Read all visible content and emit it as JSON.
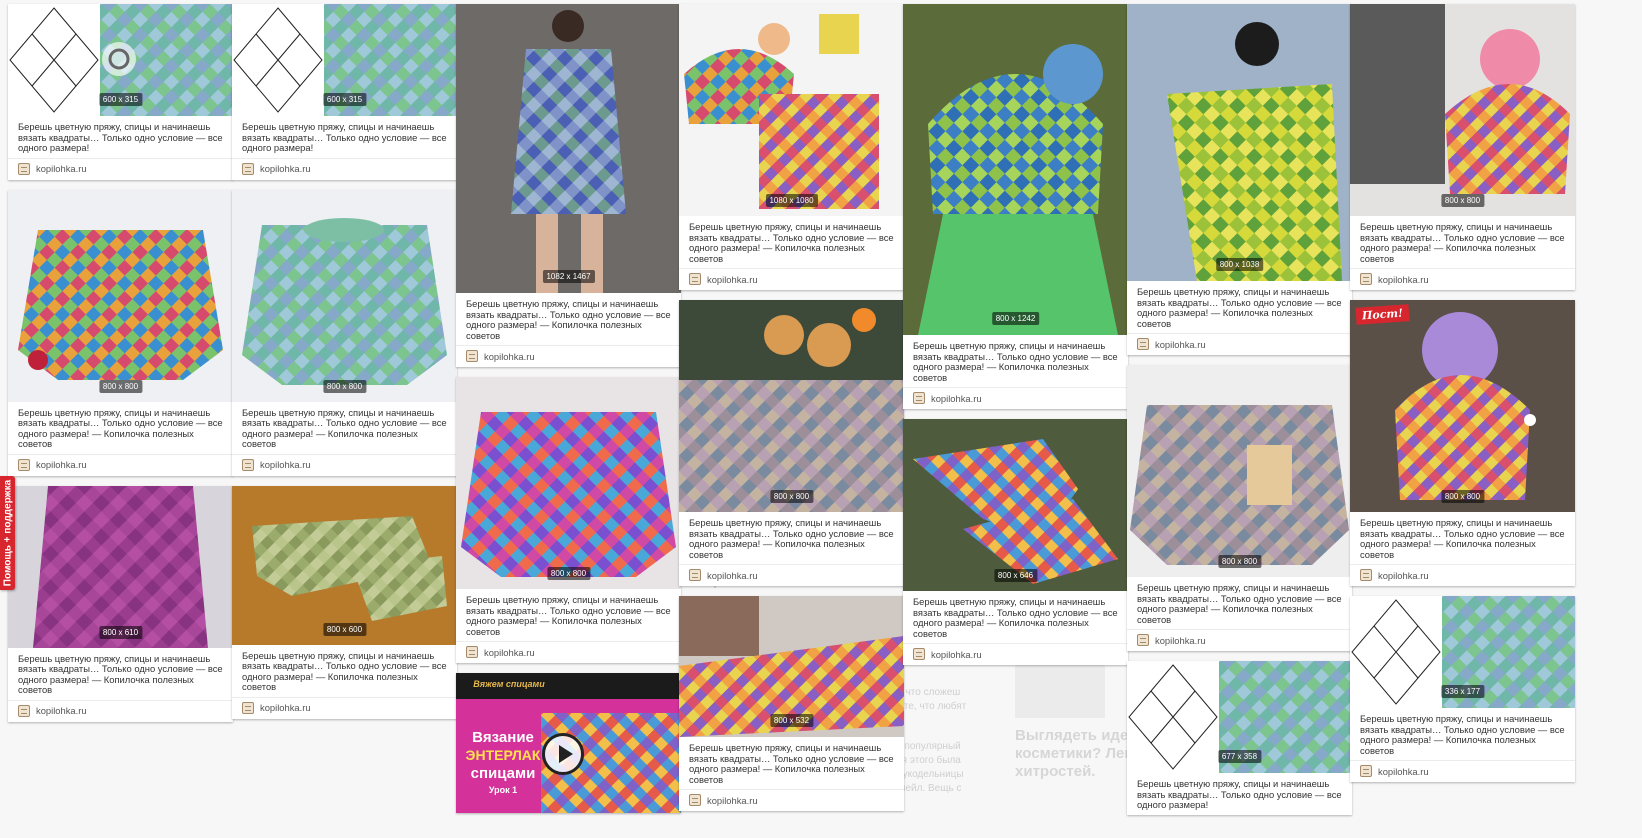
{
  "colors": {
    "support_bg": "#d8262f",
    "card_bg": "#ffffff",
    "page_bg": "#f7f7f7"
  },
  "support_tab": {
    "label": "Помощь + поддержка"
  },
  "background_text": {
    "t1": "ении энтерлак",
    "t2": "те, что сложеш",
    "t3": "не те, что любят",
    "t4": "дл популярный",
    "t5": "для этого была",
    "t6": "к рукодельницы",
    "t7": "отнейл. Вещь с",
    "t8": "Выглядеть идеа",
    "t9": "косметики? Леп",
    "t10": "хитростей."
  },
  "caption_short": "Берешь цветную пряжу, спицы и начинаешь вязать квадраты… Только одно условие — все одного размера!",
  "caption_long": "Берешь цветную пряжу, спицы и начинаешь вязать квадраты… Только одно условие — все одного размера! — Копилочка полезных советов",
  "source": "kopilohka.ru",
  "video_title": {
    "top": "Вяжем спицами",
    "l1": "Вязание",
    "l2": "ЭНТЕРЛАК",
    "l3": "спицами",
    "l4": "Урок 1"
  },
  "post_badge": "Пост!",
  "sizes": {
    "c1a": "600 x 315",
    "c2a": "600 x 315",
    "c1b": "800 x 800",
    "c2b": "800 x 800",
    "c1c": "800 x 610",
    "c2c": "800 x 600",
    "c3a": "1082 x 1467",
    "c3b": "800 x 800",
    "c4a": "1080 x 1080",
    "c4b": "800 x 800",
    "c4c": "800 x 532",
    "c5a": "800 x 1242",
    "c5b": "800 x 646",
    "c6a": "800 x 1038",
    "c6b": "800 x 800",
    "c6c": "677 x 358",
    "c7a": "800 x 800",
    "c7b": "800 x 800",
    "c7c": "336 x 177"
  },
  "icons": {
    "eye": "eye-icon",
    "play": "play-icon",
    "favicon": "site-favicon-icon"
  }
}
